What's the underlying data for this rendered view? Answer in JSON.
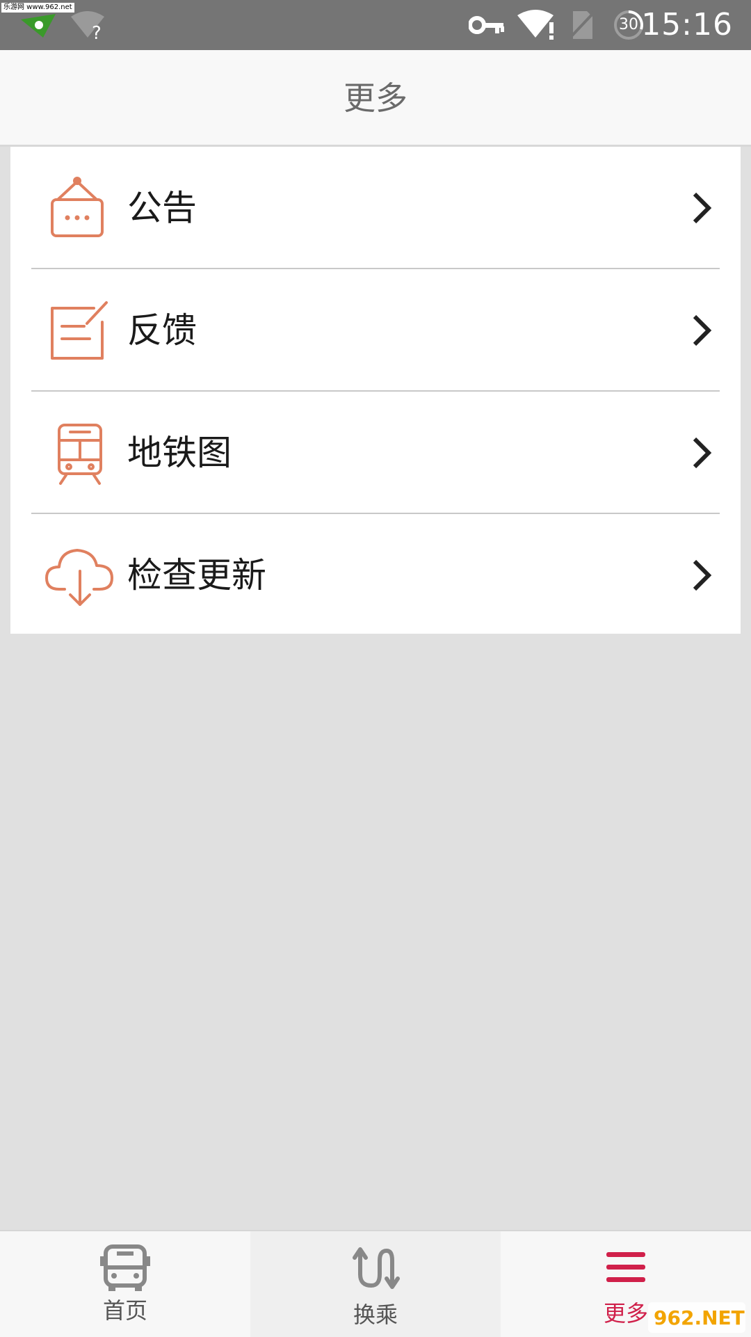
{
  "status_bar": {
    "watermark": "乐游网 www.962.net",
    "battery_level": "30",
    "time": "15:16"
  },
  "header": {
    "title": "更多"
  },
  "menu": [
    {
      "label": "公告",
      "icon": "announcement-sign-icon"
    },
    {
      "label": "反馈",
      "icon": "feedback-edit-icon"
    },
    {
      "label": "地铁图",
      "icon": "subway-train-icon"
    },
    {
      "label": "检查更新",
      "icon": "cloud-download-icon"
    }
  ],
  "bottom_nav": {
    "tabs": [
      {
        "label": "首页",
        "icon": "bus-icon",
        "active": false
      },
      {
        "label": "换乘",
        "icon": "transfer-icon",
        "active": false
      },
      {
        "label": "更多",
        "icon": "menu-icon",
        "active": true
      }
    ]
  },
  "colors": {
    "accent_icon": "#E0805F",
    "active_tab": "#D0204A",
    "status_bar": "#757575"
  },
  "bottom_watermark": "962.NET"
}
